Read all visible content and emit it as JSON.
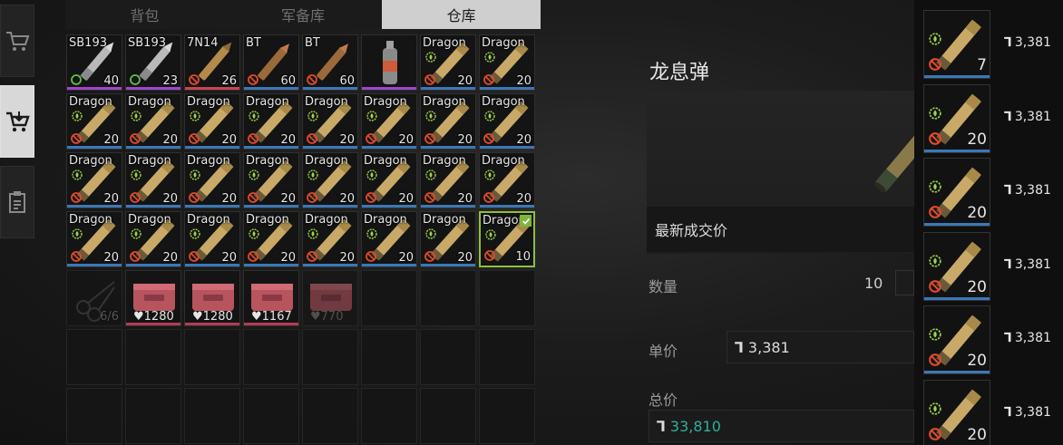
{
  "tabs": [
    {
      "label": "背包",
      "active": false
    },
    {
      "label": "军备库",
      "active": false
    },
    {
      "label": "仓库",
      "active": true
    }
  ],
  "side_nav": [
    {
      "icon": "cart-icon",
      "active": false
    },
    {
      "icon": "cart-sell-icon",
      "active": true
    },
    {
      "icon": "clipboard-icon",
      "active": false
    }
  ],
  "inventory": [
    {
      "name": "SB193",
      "count": "40",
      "type": "bullet-silver",
      "status": "ok",
      "line": "purple"
    },
    {
      "name": "SB193",
      "count": "23",
      "type": "bullet-silver",
      "status": "ok",
      "line": "purple"
    },
    {
      "name": "7N14",
      "count": "26",
      "type": "bullet-brass",
      "status": "ban",
      "line": "red"
    },
    {
      "name": "BT",
      "count": "60",
      "type": "bullet-copper",
      "status": "ban",
      "line": "blue"
    },
    {
      "name": "BT",
      "count": "60",
      "type": "bullet-copper",
      "status": "ban",
      "line": "blue"
    },
    {
      "name": "",
      "count": "",
      "type": "grenade",
      "status": "",
      "line": "purple"
    },
    {
      "name": "Dragon",
      "count": "20",
      "type": "shell",
      "status": "ban",
      "line": "blue"
    },
    {
      "name": "Dragon",
      "count": "20",
      "type": "shell",
      "status": "ban",
      "line": "blue"
    },
    {
      "name": "Dragon",
      "count": "20",
      "type": "shell",
      "status": "ban",
      "line": "blue"
    },
    {
      "name": "Dragon",
      "count": "20",
      "type": "shell",
      "status": "ban",
      "line": "blue"
    },
    {
      "name": "Dragon",
      "count": "20",
      "type": "shell",
      "status": "ban",
      "line": "blue"
    },
    {
      "name": "Dragon",
      "count": "20",
      "type": "shell",
      "status": "ban",
      "line": "blue"
    },
    {
      "name": "Dragon",
      "count": "20",
      "type": "shell",
      "status": "ban",
      "line": "blue"
    },
    {
      "name": "Dragon",
      "count": "20",
      "type": "shell",
      "status": "ban",
      "line": "blue"
    },
    {
      "name": "Dragon",
      "count": "20",
      "type": "shell",
      "status": "ban",
      "line": "blue"
    },
    {
      "name": "Dragon",
      "count": "20",
      "type": "shell",
      "status": "ban",
      "line": "blue"
    },
    {
      "name": "Dragon",
      "count": "20",
      "type": "shell",
      "status": "ban",
      "line": "blue"
    },
    {
      "name": "Dragon",
      "count": "20",
      "type": "shell",
      "status": "ban",
      "line": "blue"
    },
    {
      "name": "Dragon",
      "count": "20",
      "type": "shell",
      "status": "ban",
      "line": "blue"
    },
    {
      "name": "Dragon",
      "count": "20",
      "type": "shell",
      "status": "ban",
      "line": "blue"
    },
    {
      "name": "Dragon",
      "count": "20",
      "type": "shell",
      "status": "ban",
      "line": "blue"
    },
    {
      "name": "Dragon",
      "count": "20",
      "type": "shell",
      "status": "ban",
      "line": "blue"
    },
    {
      "name": "Dragon",
      "count": "20",
      "type": "shell",
      "status": "ban",
      "line": "blue"
    },
    {
      "name": "Dragon",
      "count": "20",
      "type": "shell",
      "status": "ban",
      "line": "blue"
    },
    {
      "name": "Dragon",
      "count": "20",
      "type": "shell",
      "status": "ban",
      "line": "blue"
    },
    {
      "name": "Dragon",
      "count": "20",
      "type": "shell",
      "status": "ban",
      "line": "blue"
    },
    {
      "name": "Dragon",
      "count": "20",
      "type": "shell",
      "status": "ban",
      "line": "blue"
    },
    {
      "name": "Dragon",
      "count": "20",
      "type": "shell",
      "status": "ban",
      "line": "blue"
    },
    {
      "name": "Dragon",
      "count": "20",
      "type": "shell",
      "status": "ban",
      "line": "blue"
    },
    {
      "name": "Dragon",
      "count": "20",
      "type": "shell",
      "status": "ban",
      "line": "blue"
    },
    {
      "name": "Dragon",
      "count": "20",
      "type": "shell",
      "status": "ban",
      "line": "blue"
    },
    {
      "name": "Dragon",
      "count": "10",
      "type": "shell",
      "status": "ban",
      "line": "",
      "selected": true
    },
    {
      "name": "",
      "count": "6/6",
      "type": "scissors",
      "status": "",
      "line": "",
      "dim": true
    },
    {
      "name": "",
      "count": "",
      "durability": "1280",
      "type": "case",
      "status": "",
      "line": "pink"
    },
    {
      "name": "",
      "count": "",
      "durability": "1280",
      "type": "case",
      "status": "",
      "line": "pink"
    },
    {
      "name": "",
      "count": "",
      "durability": "1167",
      "type": "case",
      "status": "",
      "line": "pink"
    },
    {
      "name": "",
      "count": "",
      "durability": "770",
      "type": "case",
      "status": "",
      "line": "",
      "dim": true
    },
    {
      "name": "",
      "type": "empty"
    },
    {
      "name": "",
      "type": "empty"
    },
    {
      "name": "",
      "type": "empty"
    },
    {
      "name": "",
      "type": "empty"
    },
    {
      "name": "",
      "type": "empty"
    },
    {
      "name": "",
      "type": "empty"
    },
    {
      "name": "",
      "type": "empty"
    },
    {
      "name": "",
      "type": "empty"
    },
    {
      "name": "",
      "type": "empty"
    },
    {
      "name": "",
      "type": "empty"
    },
    {
      "name": "",
      "type": "empty"
    },
    {
      "name": "",
      "type": "empty"
    },
    {
      "name": "",
      "type": "empty"
    },
    {
      "name": "",
      "type": "empty"
    },
    {
      "name": "",
      "type": "empty"
    },
    {
      "name": "",
      "type": "empty"
    },
    {
      "name": "",
      "type": "empty"
    },
    {
      "name": "",
      "type": "empty"
    },
    {
      "name": "",
      "type": "empty"
    }
  ],
  "detail": {
    "title": "龙息弹",
    "last_price_label": "最新成交价",
    "qty_label": "数量",
    "qty_value": "10",
    "unit_price_label": "单价",
    "unit_price": "3,381",
    "total_label": "总价",
    "total": "33,810",
    "currency_symbol": "⅂"
  },
  "market": [
    {
      "count": "7",
      "price": "3,381"
    },
    {
      "count": "20",
      "price": "3,381"
    },
    {
      "count": "20",
      "price": "3,381"
    },
    {
      "count": "20",
      "price": "3,381"
    },
    {
      "count": "20",
      "price": "3,381"
    },
    {
      "count": "20",
      "price": "3,381"
    }
  ],
  "colors": {
    "accent_green": "#7fb53a",
    "total_teal": "#2fae9c",
    "rarity_blue": "#3b78b7",
    "rarity_purple": "#a046c8",
    "rarity_red": "#c94552"
  }
}
